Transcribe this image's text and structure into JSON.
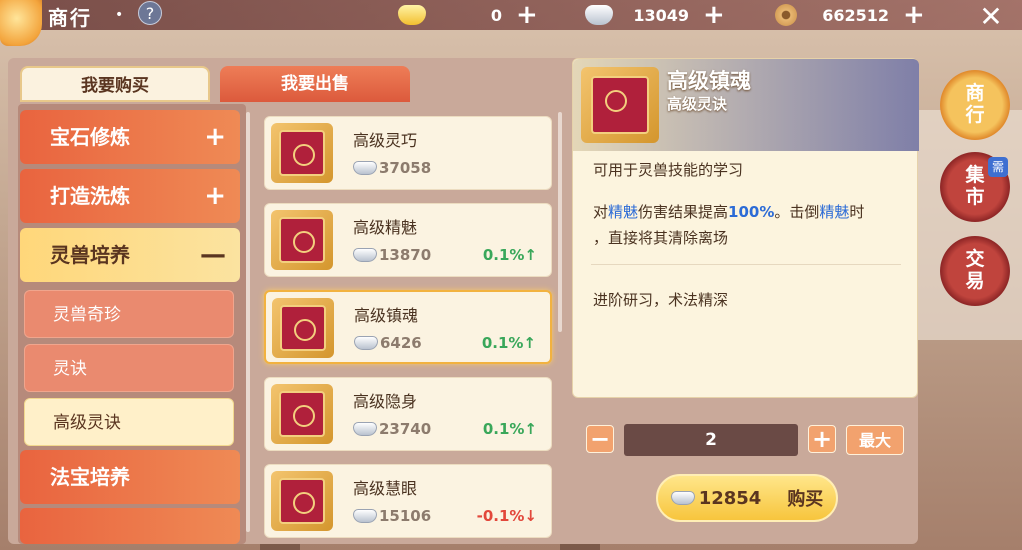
{
  "header": {
    "title": "商行",
    "help_label": "?",
    "currencies": [
      {
        "icon": "gold-ingot-icon",
        "value": "0"
      },
      {
        "icon": "silver-ingot-icon",
        "value": "13049"
      },
      {
        "icon": "copper-coin-icon",
        "value": "662512"
      }
    ],
    "plus_label": "+",
    "close_label": "✕"
  },
  "tabs": {
    "buy": "我要购买",
    "sell": "我要出售"
  },
  "categories": [
    {
      "label": "宝石修炼",
      "sign": "+"
    },
    {
      "label": "打造洗炼",
      "sign": "+"
    },
    {
      "label": "灵兽培养",
      "sign": "—"
    },
    {
      "label": "法宝培养",
      "sign": ""
    }
  ],
  "subcategories": [
    "灵兽奇珍",
    "灵诀",
    "高级灵诀"
  ],
  "items": [
    {
      "name": "高级灵巧",
      "price": "37058",
      "change": ""
    },
    {
      "name": "高级精魅",
      "price": "13870",
      "change": "0.1%↑"
    },
    {
      "name": "高级镇魂",
      "price": "6426",
      "change": "0.1%↑"
    },
    {
      "name": "高级隐身",
      "price": "23740",
      "change": "0.1%↑"
    },
    {
      "name": "高级慧眼",
      "price": "15106",
      "change": "-0.1%↓"
    }
  ],
  "detail": {
    "title": "高级镇魂",
    "type": "高级灵诀",
    "usage": "可用于灵兽技能的学习",
    "effect_pre": "对",
    "effect_hl1": "精魅",
    "effect_mid": "伤害结果提高",
    "effect_hl2": "100%",
    "effect_mid2": "。击倒",
    "effect_hl3": "精魅",
    "effect_post": "时",
    "effect_line2": "，直接将其清除离场",
    "flavor": "进阶研习，术法精深"
  },
  "quantity": {
    "minus": "−",
    "value": "2",
    "plus": "+",
    "max_label": "最大"
  },
  "buy": {
    "total": "12854",
    "label": "购买"
  },
  "side_nav": [
    {
      "label": "商\n行"
    },
    {
      "label": "集\n市",
      "badge": "需"
    },
    {
      "label": "交\n易"
    }
  ],
  "colors": {
    "accent_orange": "#e9643f",
    "gold": "#f7c53d",
    "up_green": "#39a75a",
    "down_red": "#e2473b",
    "highlight_blue": "#2c6bd6"
  }
}
